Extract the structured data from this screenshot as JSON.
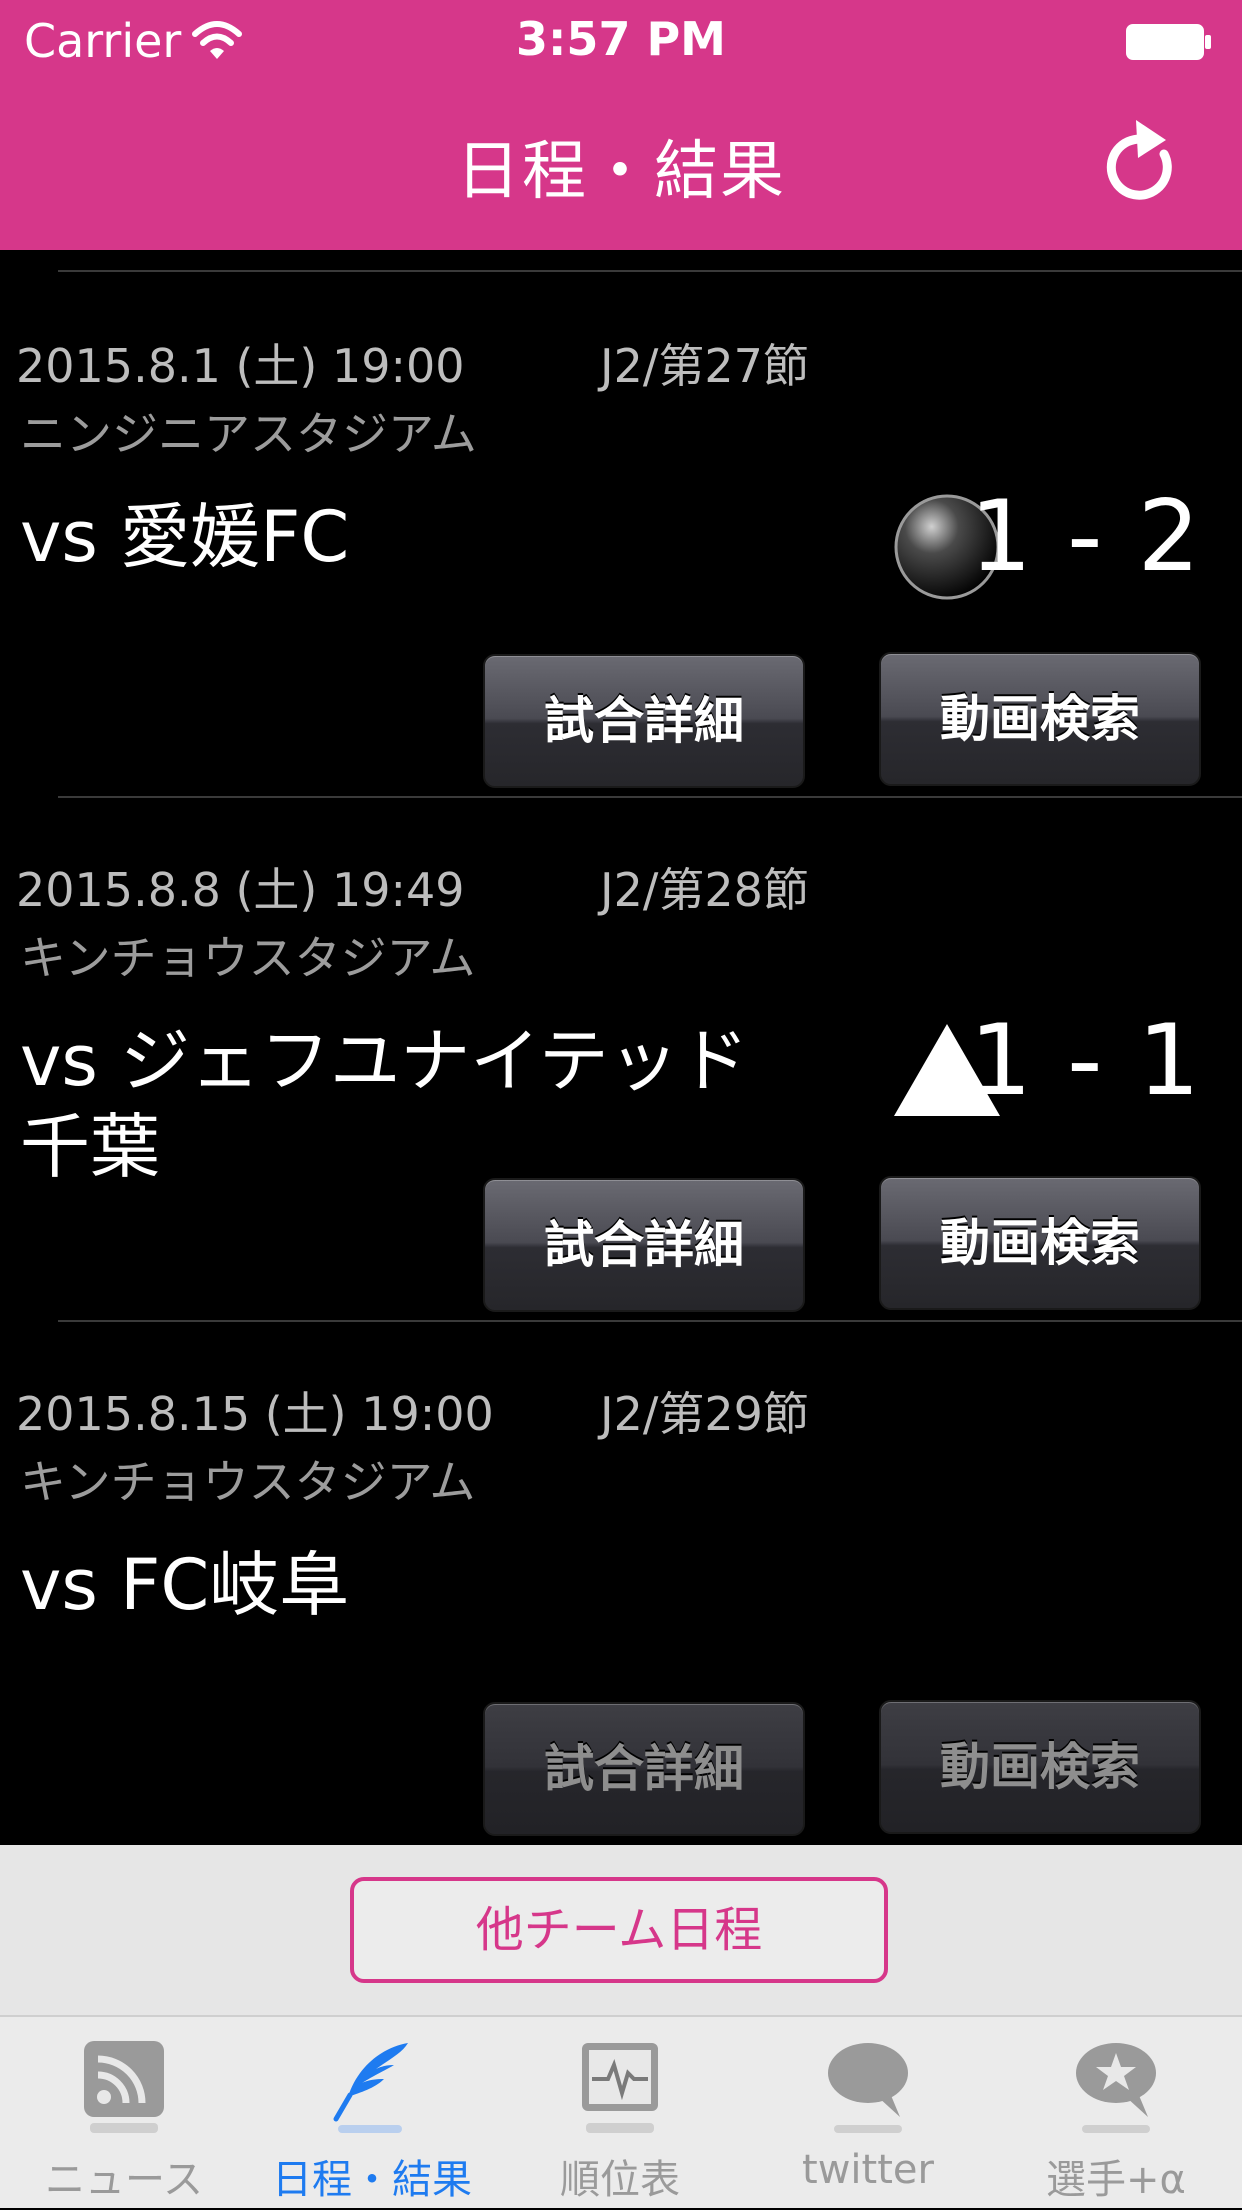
{
  "status_bar": {
    "carrier": "Carrier",
    "time": "3:57 PM"
  },
  "nav": {
    "title": "日程・結果",
    "refresh_icon": "refresh-icon"
  },
  "matches": [
    {
      "date": "2015.8.1 (土) 19:00",
      "round": "J2/第27節",
      "venue": "ニンジニアスタジアム",
      "opponent": "vs 愛媛FC",
      "result_icon": "black-circle-icon",
      "score": "1 - 2",
      "detail_label": "試合詳細",
      "video_label": "動画検索",
      "buttons_enabled": true
    },
    {
      "date": "2015.8.8 (土) 19:49",
      "round": "J2/第28節",
      "venue": "キンチョウスタジアム",
      "opponent": "vs ジェフユナイテッド千葉",
      "result_icon": "white-triangle-icon",
      "score": "1 - 1",
      "detail_label": "試合詳細",
      "video_label": "動画検索",
      "buttons_enabled": true
    },
    {
      "date": "2015.8.15 (土) 19:00",
      "round": "J2/第29節",
      "venue": "キンチョウスタジアム",
      "opponent": "vs FC岐阜",
      "result_icon": "",
      "score": "",
      "detail_label": "試合詳細",
      "video_label": "動画検索",
      "buttons_enabled": false
    }
  ],
  "other_team_button": "他チーム日程",
  "tabs": [
    {
      "label": "ニュース",
      "icon": "rss-icon",
      "active": false
    },
    {
      "label": "日程・結果",
      "icon": "feather-icon",
      "active": true
    },
    {
      "label": "順位表",
      "icon": "pulse-monitor-icon",
      "active": false
    },
    {
      "label": "twitter",
      "icon": "speech-bubble-icon",
      "active": false
    },
    {
      "label": "選手+α",
      "icon": "star-bubble-icon",
      "active": false
    }
  ],
  "colors": {
    "brand_pink": "#d6378a",
    "tab_active_blue": "#1e7bf0"
  }
}
